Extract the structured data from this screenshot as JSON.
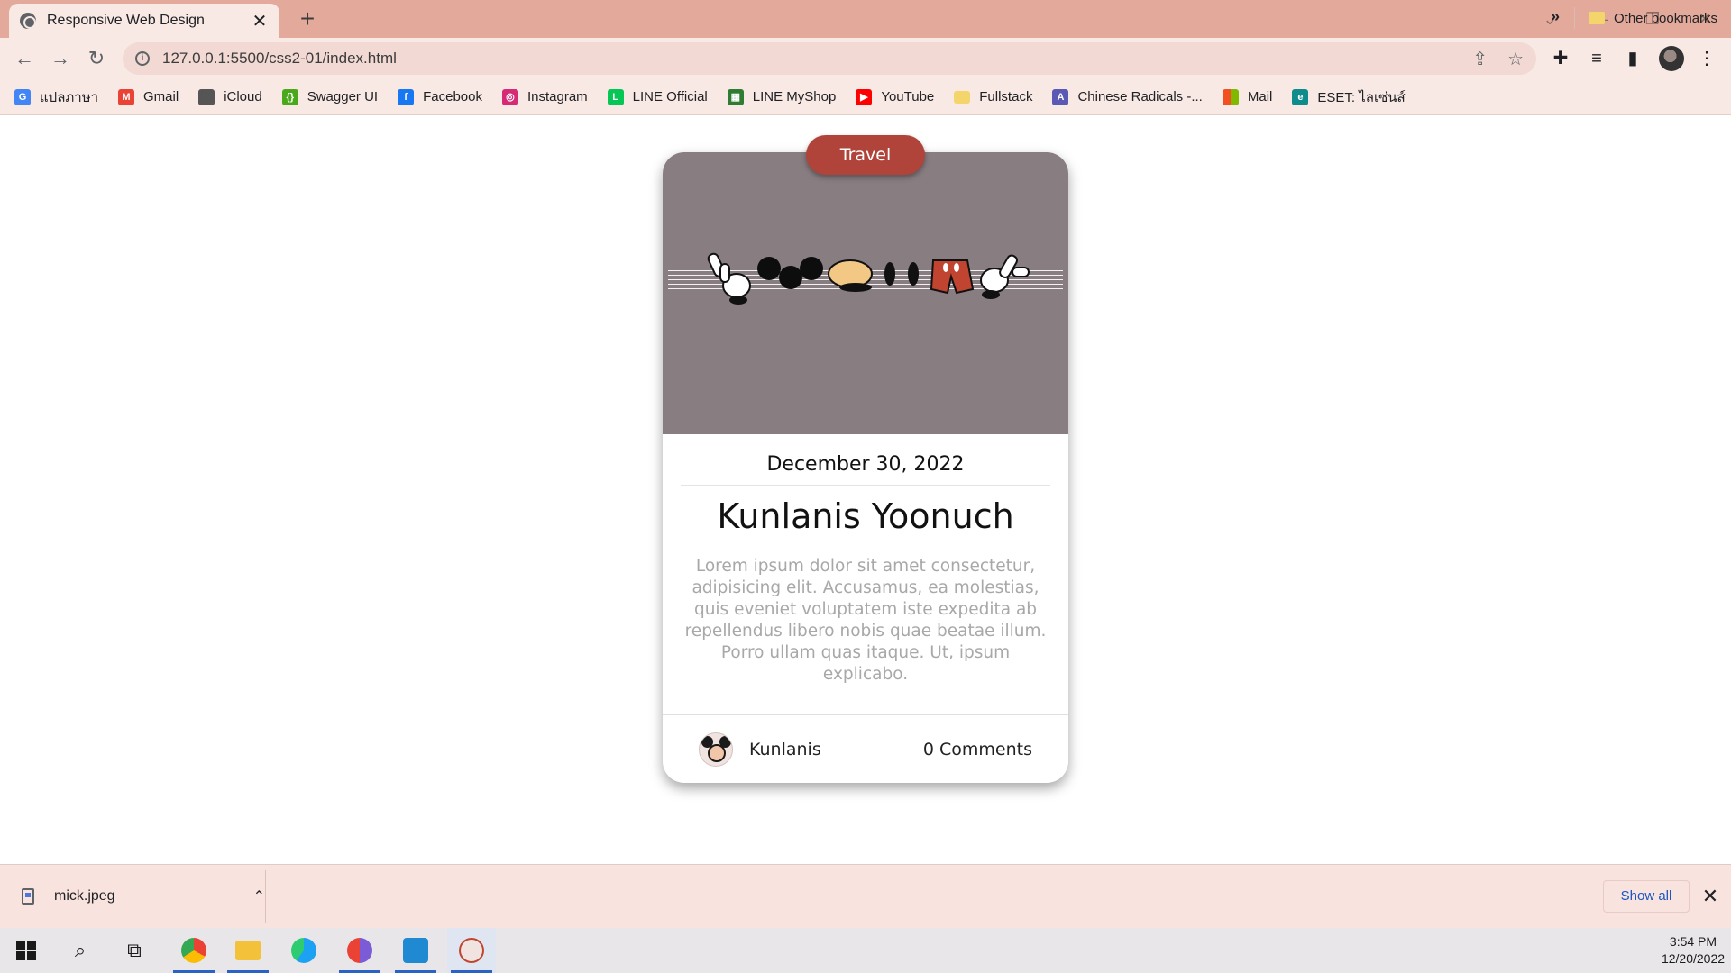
{
  "browser": {
    "tab_title": "Responsive Web Design",
    "tab_close": "✕",
    "new_tab": "+",
    "url": "127.0.0.1:5500/css2-01/index.html"
  },
  "bookmarks": [
    {
      "label": "แปลภาษา",
      "icon": "google-translate-icon",
      "color": "#4285f4"
    },
    {
      "label": "Gmail",
      "icon": "gmail-icon",
      "color": "#ea4335"
    },
    {
      "label": "iCloud",
      "icon": "apple-icon",
      "color": "#555555"
    },
    {
      "label": "Swagger UI",
      "icon": "swagger-icon",
      "color": "#49a91a"
    },
    {
      "label": "Facebook",
      "icon": "facebook-icon",
      "color": "#1877f2"
    },
    {
      "label": "Instagram",
      "icon": "instagram-icon",
      "color": "#d62976"
    },
    {
      "label": "LINE Official",
      "icon": "line-icon",
      "color": "#06c755"
    },
    {
      "label": "LINE MyShop",
      "icon": "shop-icon",
      "color": "#2e7d32"
    },
    {
      "label": "YouTube",
      "icon": "youtube-icon",
      "color": "#ff0000"
    },
    {
      "label": "Fullstack",
      "icon": "folder-icon",
      "color": "#f4d56b"
    },
    {
      "label": "Chinese Radicals -...",
      "icon": "radicals-icon",
      "color": "#5a5ab5"
    },
    {
      "label": "Mail",
      "icon": "microsoft-icon",
      "color": "#f25022"
    },
    {
      "label": "ESET: ไลเซ่นส์",
      "icon": "eset-icon",
      "color": "#0e8c8c"
    }
  ],
  "bookmarks_more": "»",
  "other_bookmarks": "Other bookmarks",
  "card": {
    "category": "Travel",
    "date": "December 30, 2022",
    "name": "Kunlanis Yoonuch",
    "description": "Lorem ipsum dolor sit amet consectetur, adipisicing elit. Accusamus, ea molestias, quis eveniet voluptatem iste expedita ab repellendus libero nobis quae beatae illum. Porro ullam quas itaque. Ut, ipsum explicabo.",
    "author": "Kunlanis",
    "comments": "0 Comments",
    "image_bg": "#887d80",
    "badge_color": "#b0443a"
  },
  "download": {
    "file_name": "mick.jpeg",
    "show_all": "Show all",
    "close": "✕"
  },
  "taskbar": {
    "time": "3:54 PM",
    "date": "12/20/2022"
  }
}
